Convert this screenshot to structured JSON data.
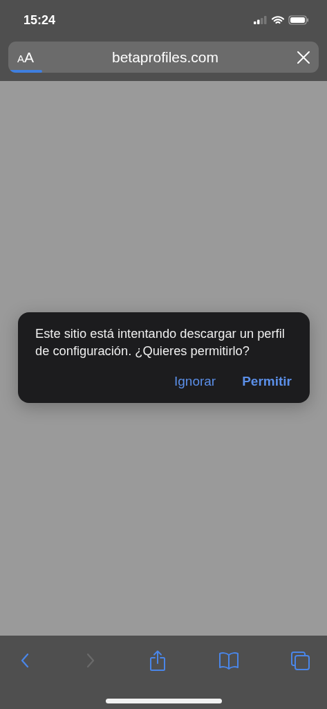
{
  "status_bar": {
    "time": "15:24"
  },
  "address_bar": {
    "text_size_button": "AA",
    "url": "betaprofiles.com",
    "load_progress": {
      "level": 0.11
    }
  },
  "dialog": {
    "message": "Este sitio está intentando descargar un perfil de configuración. ¿Quieres permitirlo?",
    "buttons": [
      {
        "label": "Ignorar",
        "kind": "secondary"
      },
      {
        "label": "Permitir",
        "kind": "primary"
      }
    ]
  },
  "toolbar": {
    "buttons": [
      {
        "kind": "back",
        "disabled": false
      },
      {
        "kind": "forward",
        "disabled": true
      },
      {
        "kind": "share",
        "disabled": false
      },
      {
        "kind": "bookmarks",
        "disabled": false
      },
      {
        "kind": "tabs",
        "disabled": false
      }
    ]
  }
}
